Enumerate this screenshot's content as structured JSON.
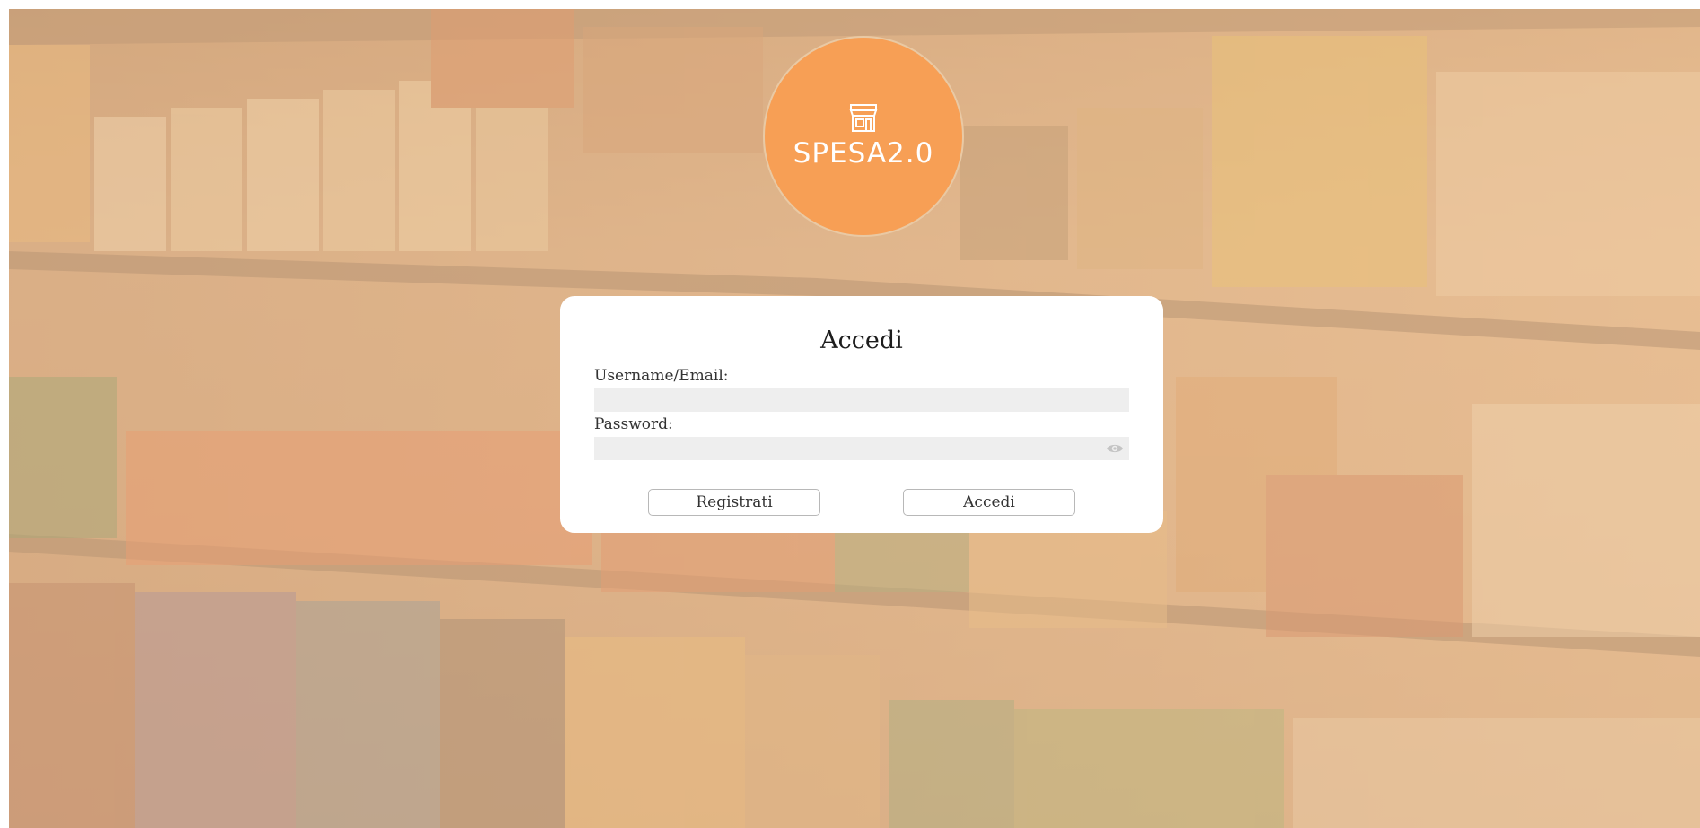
{
  "logo": {
    "text": "SPESA2.0",
    "icon": "storefront-icon",
    "color": "#f79f55"
  },
  "login": {
    "title": "Accedi",
    "username_label": "Username/Email:",
    "username_value": "",
    "password_label": "Password:",
    "password_value": "",
    "password_toggle_icon": "eye-icon",
    "register_label": "Registrati",
    "login_label": "Accedi"
  },
  "colors": {
    "accent": "#f79f55",
    "field_bg": "#eeeeee",
    "card_bg": "#ffffff"
  }
}
